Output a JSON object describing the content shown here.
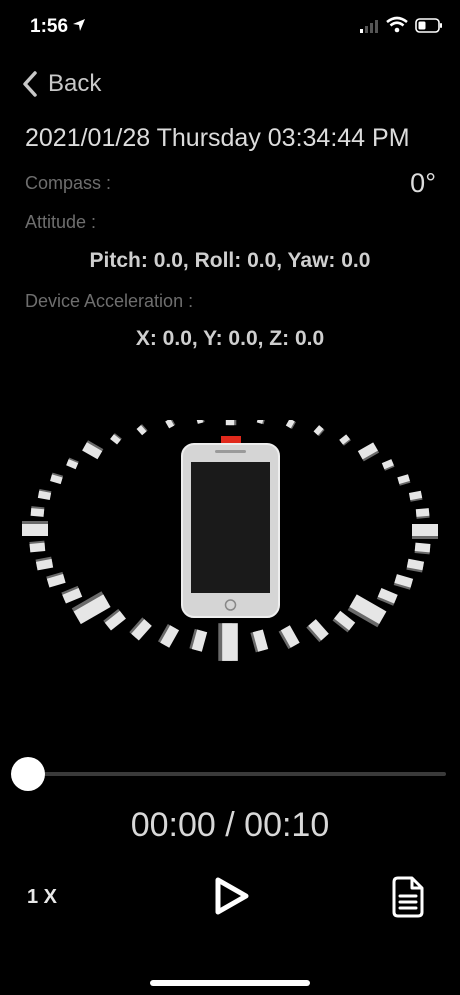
{
  "status_bar": {
    "time": "1:56"
  },
  "nav": {
    "back_label": "Back"
  },
  "datetime": "2021/01/28 Thursday 03:34:44 PM",
  "compass": {
    "label": "Compass :",
    "value": "0°"
  },
  "attitude": {
    "label": "Attitude :",
    "value": "Pitch: 0.0, Roll: 0.0, Yaw: 0.0"
  },
  "acceleration": {
    "label": "Device Acceleration :",
    "value": "X: 0.0, Y: 0.0, Z: 0.0"
  },
  "player": {
    "time": "00:00 / 00:10",
    "speed": "1 X",
    "progress": 0
  },
  "icons": {
    "play": "play-icon",
    "document": "document-icon",
    "back": "chevron-left-icon"
  },
  "colors": {
    "accent_red": "#e0291c",
    "background": "#000000"
  }
}
